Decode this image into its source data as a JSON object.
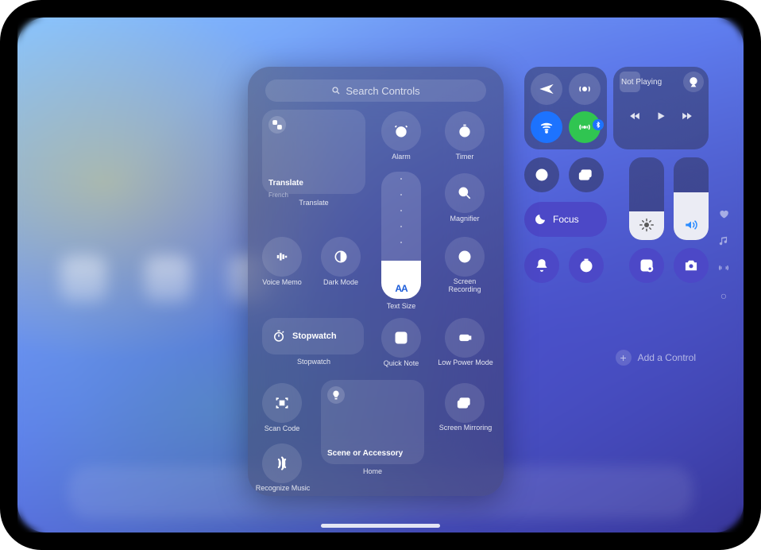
{
  "search": {
    "placeholder": "Search Controls"
  },
  "gallery": {
    "translate": {
      "title": "Translate",
      "subtitle": "French",
      "caption": "Translate"
    },
    "alarm": {
      "label": "Alarm"
    },
    "timer": {
      "label": "Timer"
    },
    "magnifier": {
      "label": "Magnifier"
    },
    "voice_memo": {
      "label": "Voice Memo"
    },
    "dark_mode": {
      "label": "Dark Mode"
    },
    "text_size": {
      "label": "Text Size",
      "glyph": "AA"
    },
    "screen_recording": {
      "label": "Screen Recording"
    },
    "stopwatch_tile": {
      "title": "Stopwatch",
      "caption": "Stopwatch"
    },
    "quick_note": {
      "label": "Quick Note"
    },
    "low_power": {
      "label": "Low Power Mode"
    },
    "scan_code": {
      "label": "Scan Code"
    },
    "screen_mirroring": {
      "label": "Screen Mirroring"
    },
    "home_tile": {
      "title": "Scene or Accessory",
      "caption": "Home"
    },
    "recognize_music": {
      "label": "Recognize Music"
    }
  },
  "cc": {
    "media": {
      "label": "Not Playing"
    },
    "focus": {
      "label": "Focus"
    },
    "brightness_pct": 35,
    "volume_pct": 58
  },
  "colors": {
    "blue": "#1d73ff",
    "green": "#30c551",
    "indigo": "#4c48c7"
  },
  "add_control": {
    "label": "Add a Control"
  }
}
